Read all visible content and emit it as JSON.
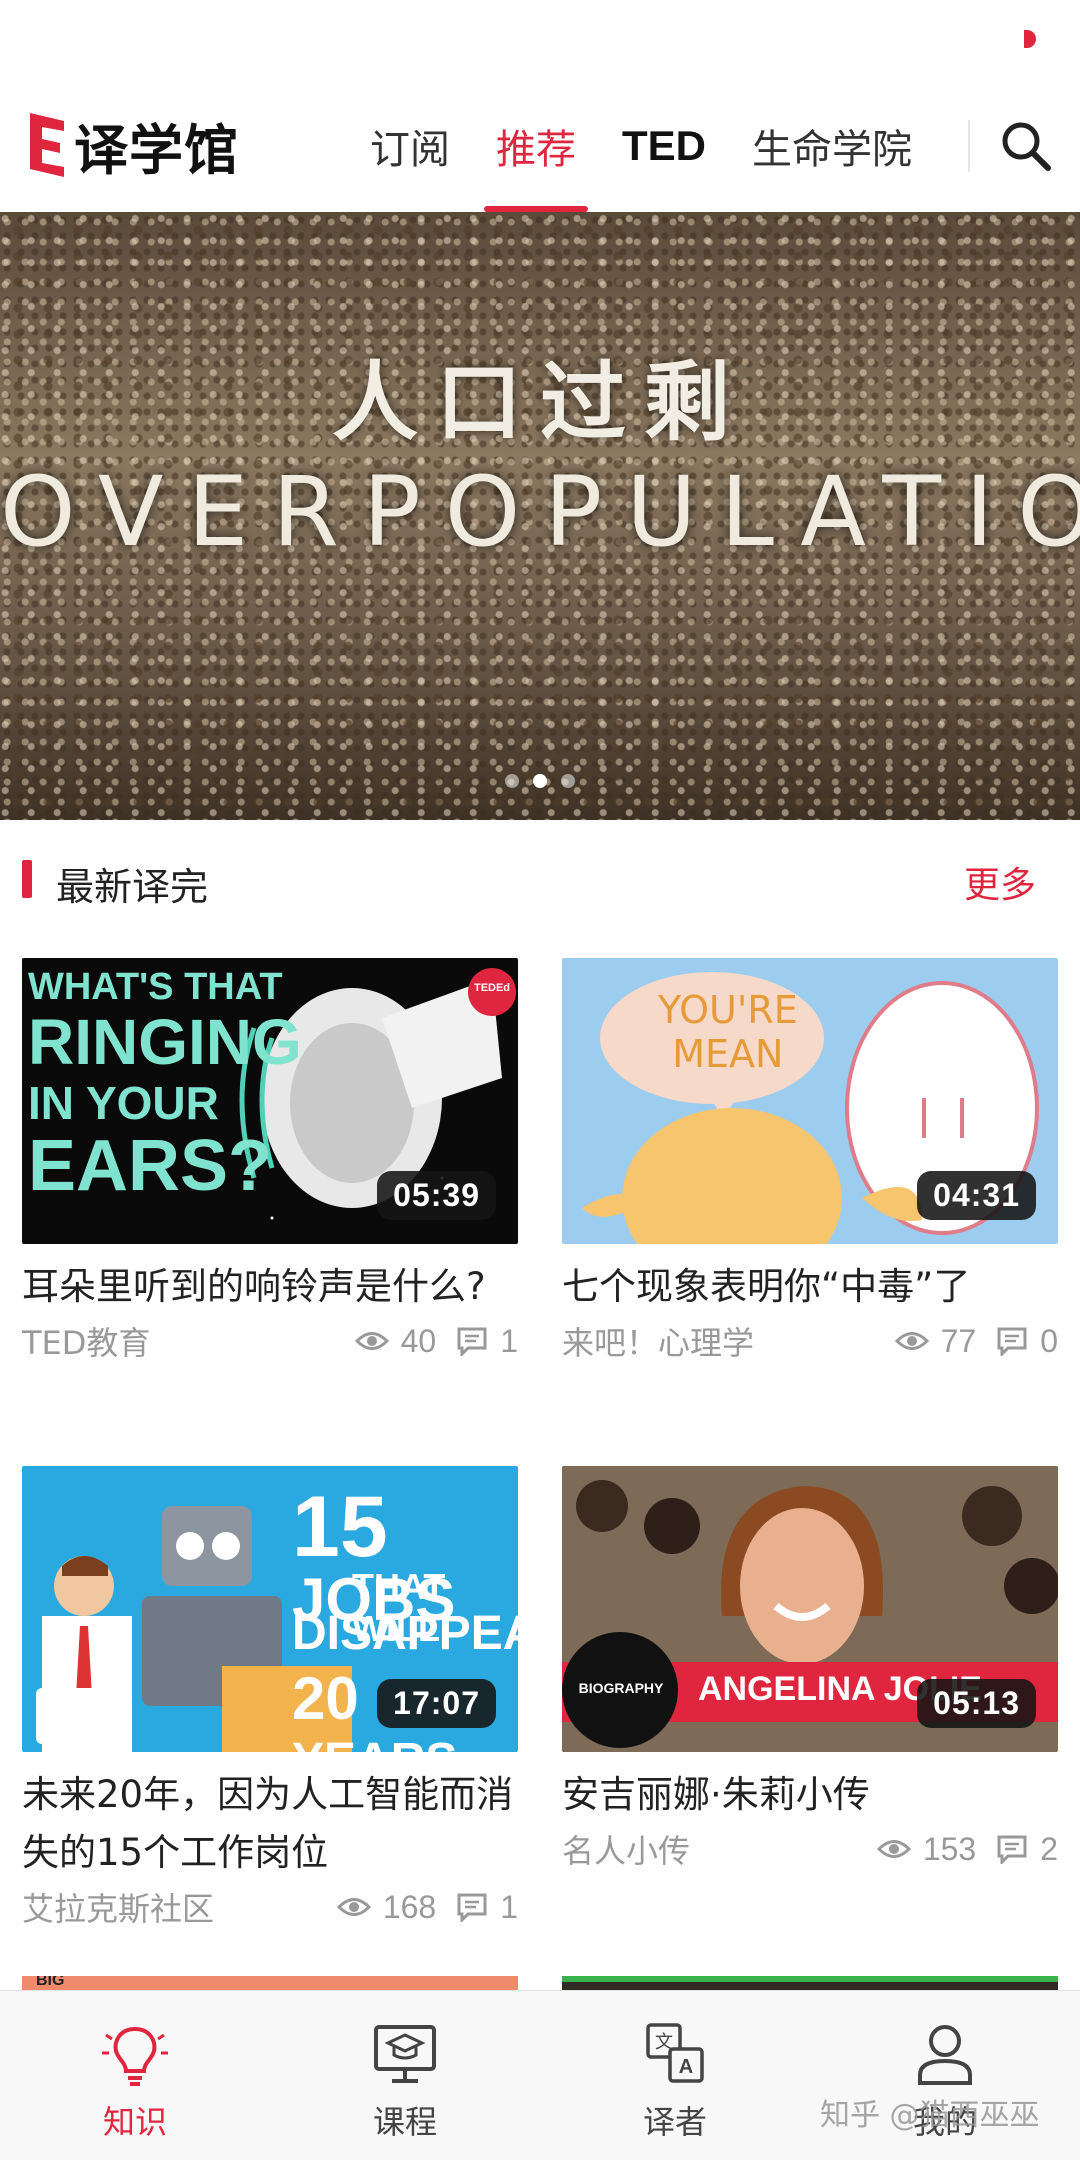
{
  "app": {
    "name": "译学馆"
  },
  "nav": {
    "tabs": [
      {
        "label": "订阅"
      },
      {
        "label": "推荐"
      },
      {
        "label": "TED"
      },
      {
        "label": "生命学院"
      }
    ],
    "active_tab": "推荐",
    "search_icon": "search-icon"
  },
  "banner": {
    "title_cn": "人口过剩",
    "title_en": "OVERPOPULATION",
    "dots": 3,
    "active_dot": 2
  },
  "section": {
    "title": "最新译完",
    "more_label": "更多"
  },
  "cards": [
    {
      "title": "耳朵里听到的响铃声是什么?",
      "channel": "TED教育",
      "views": "40",
      "comments": "1",
      "duration": "05:39",
      "thumb_text": [
        "WHAT'S THAT",
        "RINGING",
        "IN YOUR",
        "EARS?"
      ],
      "badge": "TEDEd"
    },
    {
      "title": "七个现象表明你“中毒”了",
      "channel": "来吧！心理学",
      "views": "77",
      "comments": "0",
      "duration": "04:31",
      "thumb_text": [
        "YOU'RE",
        "MEAN"
      ]
    },
    {
      "title": "未来20年，因为人工智能而消失的15个工作岗位",
      "channel": "艾拉克斯社区",
      "views": "168",
      "comments": "1",
      "duration": "17:07",
      "thumb_text": [
        "15",
        "JOBS",
        "THAT WILL",
        "DISAPPEAR",
        "20",
        "YEARS"
      ]
    },
    {
      "title": "安吉丽娜·朱莉小传",
      "channel": "名人小传",
      "views": "153",
      "comments": "2",
      "duration": "05:13",
      "thumb_text": [
        "BIOGRAPHY",
        "ANGELINA JOLIE"
      ]
    }
  ],
  "partial_row": {
    "left_thumb_text": "BIG"
  },
  "tabbar": {
    "items": [
      {
        "label": "知识",
        "icon": "lightbulb-icon"
      },
      {
        "label": "课程",
        "icon": "graduation-board-icon"
      },
      {
        "label": "译者",
        "icon": "translate-icon"
      },
      {
        "label": "我的",
        "icon": "user-icon"
      }
    ],
    "active": "知识"
  },
  "watermark": "知乎 @猫西巫巫",
  "colors": {
    "accent": "#e0263f",
    "text": "#222222",
    "muted": "#999999"
  }
}
